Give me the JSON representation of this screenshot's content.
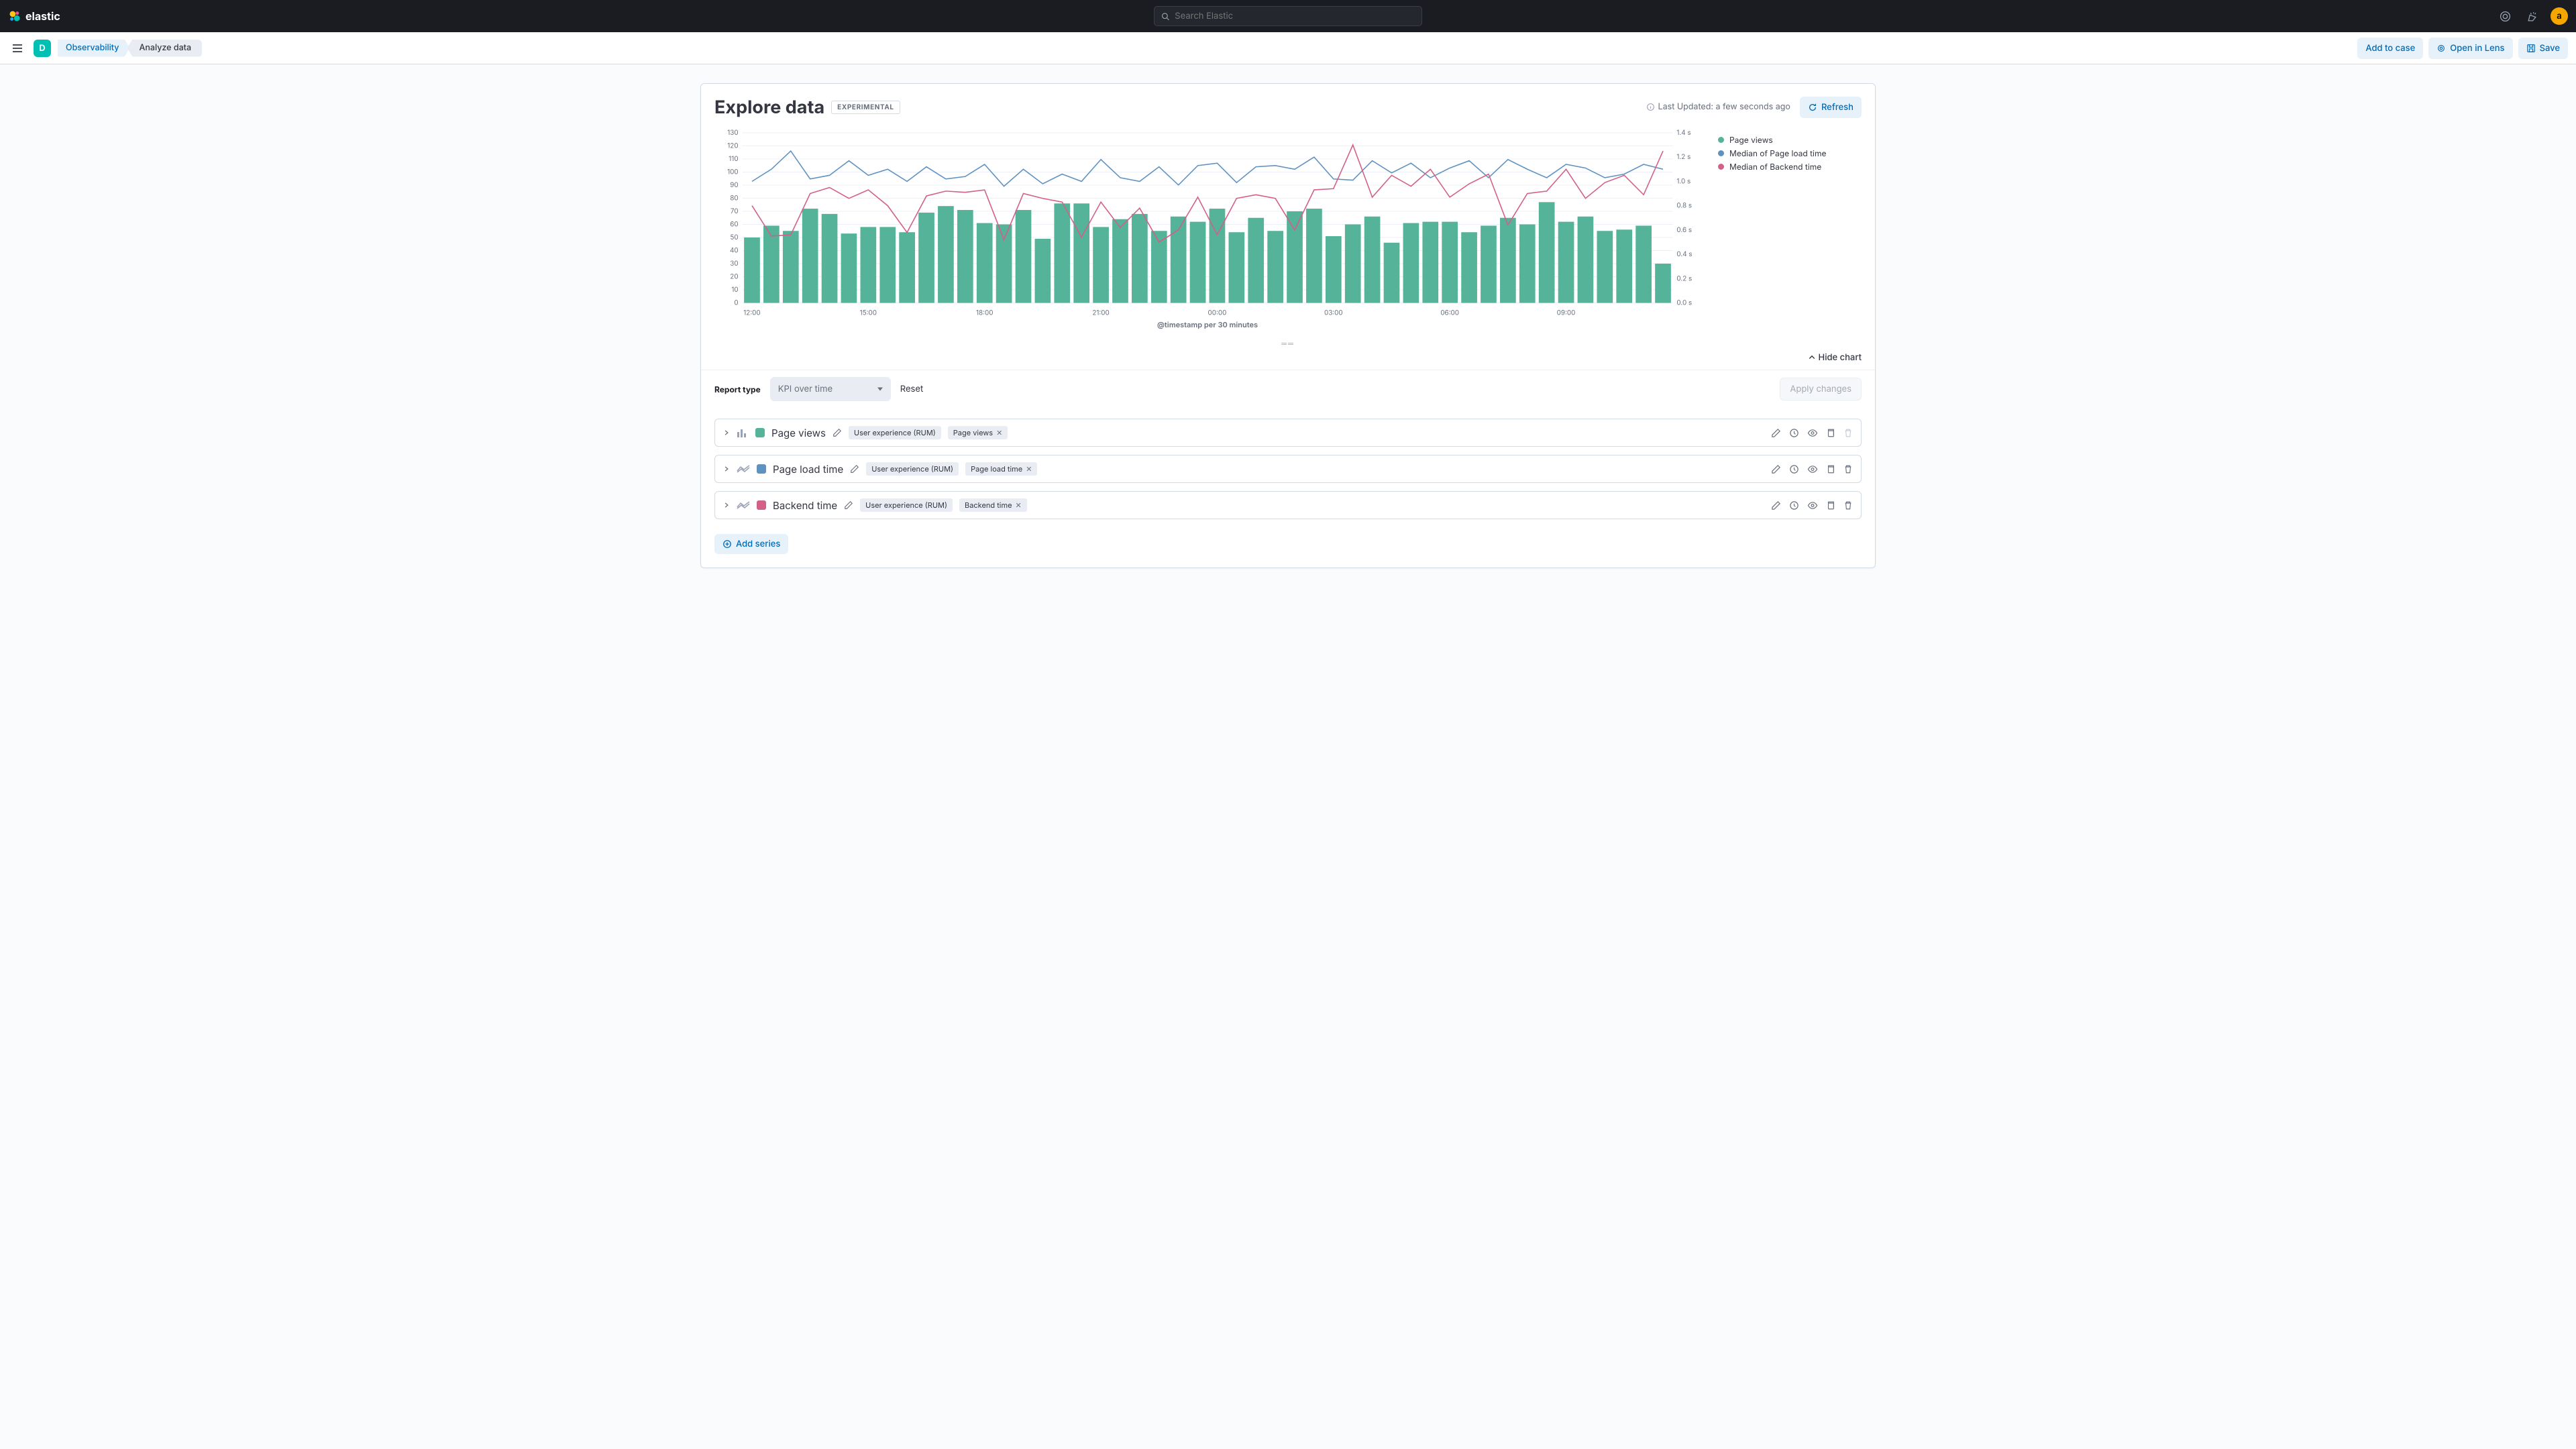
{
  "header": {
    "logo_text": "elastic",
    "search_placeholder": "Search Elastic",
    "avatar_letter": "a"
  },
  "subheader": {
    "space_letter": "D",
    "breadcrumbs": [
      {
        "label": "Observability",
        "link": true
      },
      {
        "label": "Analyze data",
        "link": false
      }
    ],
    "buttons": {
      "add_case": "Add to case",
      "open_lens": "Open in Lens",
      "save": "Save"
    }
  },
  "page": {
    "title": "Explore data",
    "badge": "EXPERIMENTAL",
    "last_updated": "Last Updated: a few seconds ago",
    "refresh": "Refresh",
    "hide_chart": "Hide chart"
  },
  "controls": {
    "report_type_label": "Report type",
    "report_type_value": "KPI over time",
    "reset": "Reset",
    "apply": "Apply changes"
  },
  "legend": {
    "items": [
      {
        "label": "Page views",
        "color": "#54b399"
      },
      {
        "label": "Median of Page load time",
        "color": "#6092c0"
      },
      {
        "label": "Median of Backend time",
        "color": "#d36086"
      }
    ]
  },
  "series": [
    {
      "name": "Page views",
      "type": "bar",
      "color": "#54b399",
      "data_tag": "User experience (RUM)",
      "metric_tag": "Page views",
      "delete_disabled": true
    },
    {
      "name": "Page load time",
      "type": "line",
      "color": "#6092c0",
      "data_tag": "User experience (RUM)",
      "metric_tag": "Page load time",
      "delete_disabled": false
    },
    {
      "name": "Backend time",
      "type": "line",
      "color": "#d36086",
      "data_tag": "User experience (RUM)",
      "metric_tag": "Backend time",
      "delete_disabled": false
    }
  ],
  "add_series": "Add series",
  "chart_data": {
    "type": "combo-bar-line",
    "xlabel": "@timestamp per 30 minutes",
    "x_ticks": [
      "12:00",
      "15:00",
      "18:00",
      "21:00",
      "00:00",
      "03:00",
      "06:00",
      "09:00"
    ],
    "y_left": {
      "min": 0,
      "max": 130,
      "step": 10,
      "label": ""
    },
    "y_right": {
      "min": 0,
      "max": 1.4,
      "step": 0.2,
      "unit": "s",
      "label": ""
    },
    "bars": {
      "name": "Page views",
      "color": "#54b399",
      "values": [
        50,
        59,
        55,
        72,
        68,
        53,
        58,
        58,
        54,
        69,
        74,
        71,
        61,
        60,
        71,
        49,
        76,
        76,
        58,
        64,
        68,
        55,
        66,
        62,
        72,
        54,
        65,
        55,
        70,
        72,
        51,
        60,
        66,
        46,
        61,
        62,
        62,
        54,
        59,
        65,
        60,
        77,
        62,
        66,
        55,
        56,
        59,
        30
      ]
    },
    "lines": [
      {
        "name": "Median of Page load time",
        "color": "#6092c0",
        "axis": "right",
        "values": [
          1.0,
          1.1,
          1.25,
          1.02,
          1.05,
          1.17,
          1.05,
          1.1,
          1.0,
          1.12,
          1.02,
          1.04,
          1.14,
          0.96,
          1.1,
          0.98,
          1.06,
          1.0,
          1.18,
          1.03,
          1.0,
          1.12,
          0.97,
          1.13,
          1.15,
          0.99,
          1.12,
          1.13,
          1.1,
          1.2,
          1.02,
          1.01,
          1.17,
          1.07,
          1.15,
          1.03,
          1.11,
          1.17,
          1.03,
          1.18,
          1.1,
          1.03,
          1.14,
          1.11,
          1.03,
          1.06,
          1.14,
          1.1
        ]
      },
      {
        "name": "Median of Backend time",
        "color": "#d36086",
        "axis": "right",
        "values": [
          0.8,
          0.55,
          0.56,
          0.9,
          0.95,
          0.86,
          0.93,
          0.8,
          0.58,
          0.88,
          0.92,
          0.91,
          0.93,
          0.52,
          0.9,
          0.86,
          0.83,
          0.54,
          0.83,
          0.62,
          0.78,
          0.5,
          0.6,
          0.87,
          0.56,
          0.86,
          0.89,
          0.86,
          0.6,
          0.93,
          0.94,
          1.3,
          0.87,
          1.05,
          0.96,
          1.1,
          0.87,
          0.98,
          1.06,
          0.64,
          0.9,
          0.92,
          1.1,
          0.86,
          0.99,
          1.05,
          0.89,
          1.25
        ]
      }
    ]
  }
}
